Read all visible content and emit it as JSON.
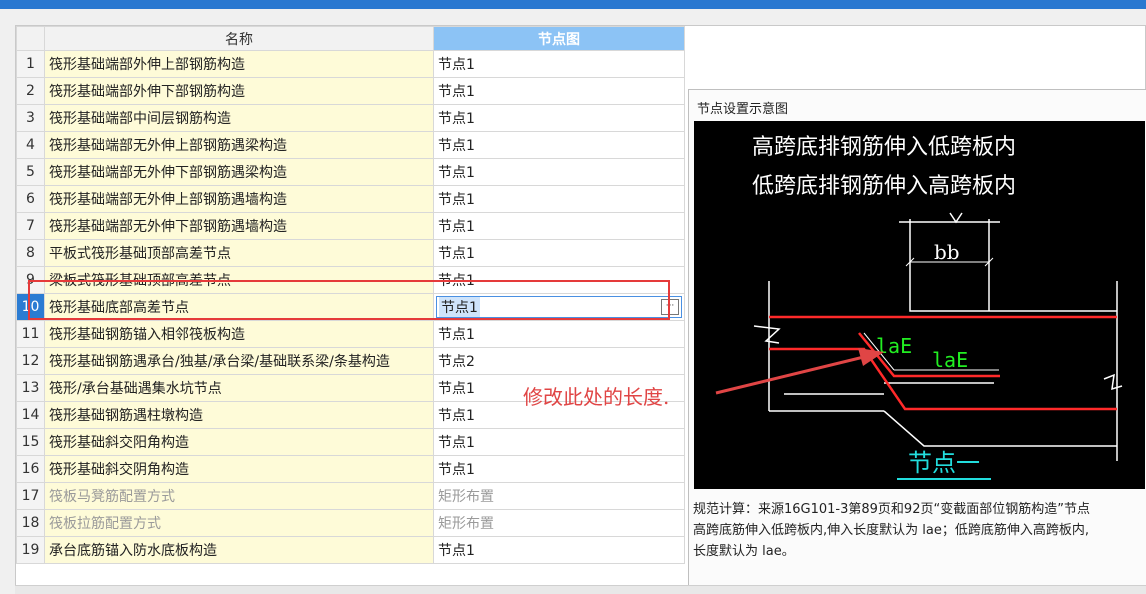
{
  "grid": {
    "columns": {
      "name": "名称",
      "node": "节点图"
    },
    "rows": [
      {
        "num": "1",
        "name": "筏形基础端部外伸上部钢筋构造",
        "node": "节点1"
      },
      {
        "num": "2",
        "name": "筏形基础端部外伸下部钢筋构造",
        "node": "节点1"
      },
      {
        "num": "3",
        "name": "筏形基础端部中间层钢筋构造",
        "node": "节点1"
      },
      {
        "num": "4",
        "name": "筏形基础端部无外伸上部钢筋遇梁构造",
        "node": "节点1"
      },
      {
        "num": "5",
        "name": "筏形基础端部无外伸下部钢筋遇梁构造",
        "node": "节点1"
      },
      {
        "num": "6",
        "name": "筏形基础端部无外伸上部钢筋遇墙构造",
        "node": "节点1"
      },
      {
        "num": "7",
        "name": "筏形基础端部无外伸下部钢筋遇墙构造",
        "node": "节点1"
      },
      {
        "num": "8",
        "name": "平板式筏形基础顶部高差节点",
        "node": "节点1"
      },
      {
        "num": "9",
        "name": "梁板式筏形基础顶部高差节点",
        "node": "节点1"
      },
      {
        "num": "10",
        "name": "筏形基础底部高差节点",
        "node": "节点1",
        "selected": true
      },
      {
        "num": "11",
        "name": "筏形基础钢筋锚入相邻筏板构造",
        "node": "节点1"
      },
      {
        "num": "12",
        "name": "筏形基础钢筋遇承台/独基/承台梁/基础联系梁/条基构造",
        "node": "节点2"
      },
      {
        "num": "13",
        "name": "筏形/承台基础遇集水坑节点",
        "node": "节点1"
      },
      {
        "num": "14",
        "name": "筏形基础钢筋遇柱墩构造",
        "node": "节点1"
      },
      {
        "num": "15",
        "name": "筏形基础斜交阳角构造",
        "node": "节点1"
      },
      {
        "num": "16",
        "name": "筏形基础斜交阴角构造",
        "node": "节点1"
      },
      {
        "num": "17",
        "name": "筏板马凳筋配置方式",
        "node": "矩形布置",
        "disabled": true
      },
      {
        "num": "18",
        "name": "筏板拉筋配置方式",
        "node": "矩形布置",
        "disabled": true
      },
      {
        "num": "19",
        "name": "承台底筋锚入防水底板构造",
        "node": "节点1"
      }
    ]
  },
  "preview": {
    "title": "节点设置示意图",
    "diagram": {
      "line1": "高跨底排钢筋伸入低跨板内",
      "line2": "低跨底排钢筋伸入高跨板内",
      "dim_bb": "bb",
      "label_lae_1": "laE",
      "label_lae_2": "laE",
      "caption": "节点一"
    },
    "desc_line1": "规范计算：来源16G101-3第89页和92页“变截面部位钢筋构造”节点",
    "desc_line2": "高跨底筋伸入低跨板内,伸入长度默认为 lae；低跨底筋伸入高跨板内,",
    "desc_line3": "长度默认为 lae。"
  },
  "annotation": {
    "text": "修改此处的长度."
  },
  "colors": {
    "selection": "#2b7cd3",
    "name_cell_bg": "#fefbd8",
    "header_active": "#8cc3f5",
    "annotation": "#e53a3a"
  }
}
